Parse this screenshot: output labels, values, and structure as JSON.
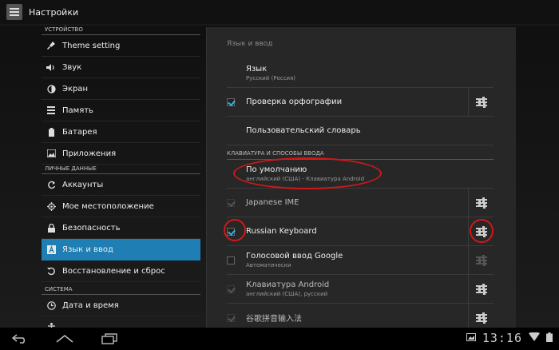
{
  "actionbar": {
    "title": "Настройки"
  },
  "left": {
    "sections": [
      {
        "header": "УСТРОЙСТВО",
        "items": [
          {
            "label": "Theme setting",
            "icon": "brush-icon"
          },
          {
            "label": "Звук",
            "icon": "speaker-icon"
          },
          {
            "label": "Экран",
            "icon": "brightness-icon"
          },
          {
            "label": "Память",
            "icon": "storage-icon"
          },
          {
            "label": "Батарея",
            "icon": "battery-icon"
          },
          {
            "label": "Приложения",
            "icon": "apps-icon"
          }
        ]
      },
      {
        "header": "ЛИЧНЫЕ ДАННЫЕ",
        "items": [
          {
            "label": "Аккаунты",
            "icon": "sync-icon"
          },
          {
            "label": "Мое местоположение",
            "icon": "location-icon"
          },
          {
            "label": "Безопасность",
            "icon": "lock-icon"
          },
          {
            "label": "Язык и ввод",
            "icon": "language-icon",
            "active": true
          },
          {
            "label": "Восстановление и сброс",
            "icon": "reset-icon"
          }
        ]
      },
      {
        "header": "СИСТЕМА",
        "items": [
          {
            "label": "Дата и время",
            "icon": "clock-icon"
          }
        ]
      }
    ]
  },
  "right": {
    "title": "Язык и ввод",
    "items": [
      {
        "title": "Язык",
        "summary": "Русский (Россия)"
      },
      {
        "title": "Проверка орфографии",
        "checked": true
      },
      {
        "title": "Пользовательский словарь"
      }
    ],
    "keyboard_header": "КЛАВИАТУРА И СПОСОБЫ ВВОДА",
    "default": {
      "title": "По умолчанию",
      "summary": "английский (США) - Клавиатура Android"
    },
    "ime": [
      {
        "title": "Japanese IME",
        "checked": true,
        "enabled": false
      },
      {
        "title": "Russian Keyboard",
        "checked": true,
        "enabled": true
      },
      {
        "title": "Голосовой ввод Google",
        "summary": "Автоматически",
        "checked": false,
        "enabled": true
      },
      {
        "title": "Клавиатура Android",
        "summary": "английский (США), русский",
        "checked": true,
        "enabled": false
      },
      {
        "title": "谷歌拼音输入法",
        "checked": true,
        "enabled": false
      }
    ]
  },
  "navbar": {
    "time": "13:16"
  },
  "colors": {
    "accent": "#33b5e5",
    "selected": "#1f7fb4",
    "annotation": "#d01818"
  }
}
